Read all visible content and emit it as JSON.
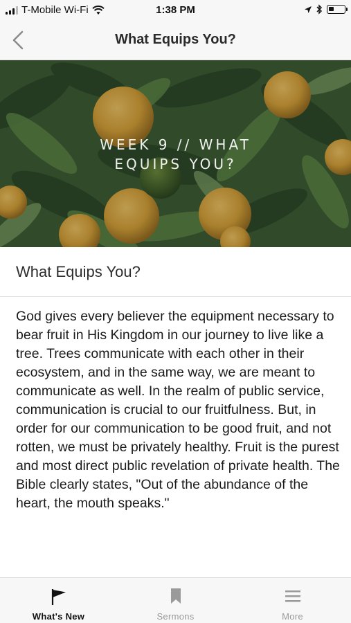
{
  "status_bar": {
    "carrier": "T-Mobile Wi-Fi",
    "time": "1:38 PM"
  },
  "nav": {
    "title": "What Equips You?"
  },
  "hero": {
    "title_line1": "WEEK 9 // WHAT",
    "title_line2": "EQUIPS YOU?"
  },
  "content": {
    "title": "What Equips You?",
    "body": "God gives every believer the equipment necessary to bear fruit in His Kingdom in our journey to live like a tree. Trees communicate with each other in their ecosystem, and in the same way, we are meant to communicate as well. In the realm of public service, communication is crucial to our fruitfulness. But, in order for our communication to be good fruit, and not rotten, we must be privately healthy. Fruit is the purest and most direct public revelation of private health. The Bible clearly states, \"Out of the abundance of the heart, the mouth speaks.\""
  },
  "tabs": [
    {
      "label": "What's New",
      "icon": "flag-icon",
      "active": true
    },
    {
      "label": "Sermons",
      "icon": "bookmark-icon",
      "active": false
    },
    {
      "label": "More",
      "icon": "menu-icon",
      "active": false
    }
  ],
  "colors": {
    "bar_background": "#f7f7f7",
    "active_tab": "#111111",
    "inactive_tab": "#9a9a9a",
    "hero_base": "#3e5c33",
    "fruit": "#d9a43a"
  }
}
